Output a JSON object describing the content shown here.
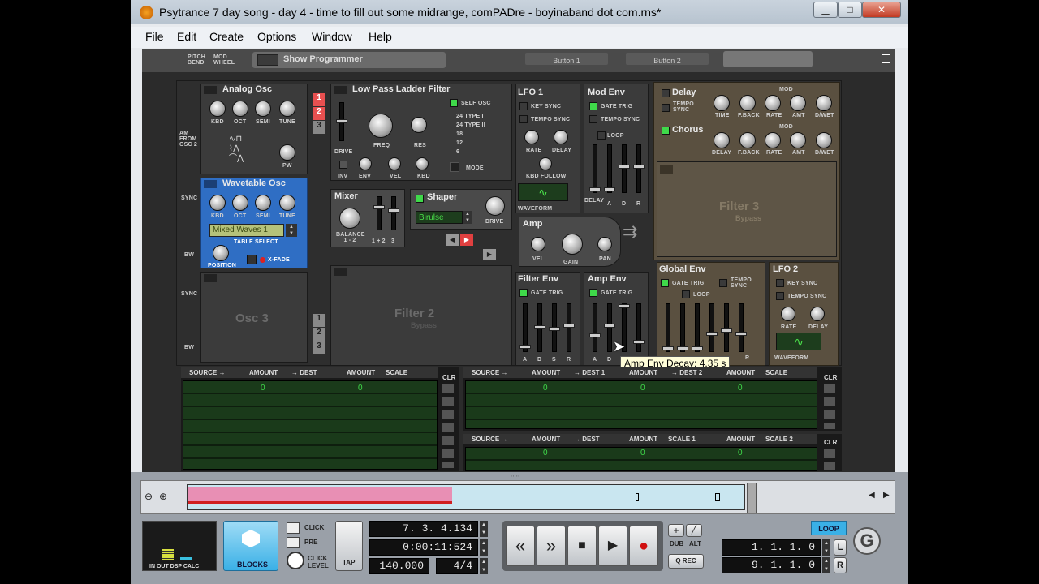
{
  "window": {
    "title": "Psytrance 7 day song - day 4 - time to fill out some midrange, comPADre - boyinaband dot com.rns*",
    "minimize": "▁",
    "maximize": "□",
    "close": "✕"
  },
  "menu": [
    "File",
    "Edit",
    "Create",
    "Options",
    "Window",
    "Help"
  ],
  "top": {
    "pitch_bend": "PITCH BEND",
    "mod_wheel": "MOD WHEEL",
    "show_programmer": "Show Programmer",
    "button1": "Button 1",
    "button2": "Button 2"
  },
  "analog_osc": {
    "title": "Analog Osc",
    "knobs": [
      "KBD",
      "OCT",
      "SEMI",
      "TUNE"
    ],
    "pw": "PW",
    "am_from": "AM FROM OSC 2"
  },
  "wavetable_osc": {
    "title": "Wavetable Osc",
    "knobs": [
      "KBD",
      "OCT",
      "SEMI",
      "TUNE"
    ],
    "wave": "Mixed Waves 1",
    "table_select": "TABLE SELECT",
    "position": "POSITION",
    "xfade": "X-FADE",
    "sync": "SYNC",
    "bw": "BW"
  },
  "osc3": {
    "title": "Osc 3",
    "sync": "SYNC",
    "bw": "BW"
  },
  "slots": [
    "1",
    "2",
    "3"
  ],
  "filter": {
    "title": "Low Pass Ladder Filter",
    "self_osc": "SELF OSC",
    "types": [
      "24 TYPE I",
      "24 TYPE II",
      "18",
      "12",
      "6"
    ],
    "mode": "MODE",
    "freq": "FREQ",
    "res": "RES",
    "drive": "DRIVE",
    "inv": "INV",
    "env": "ENV",
    "vel": "VEL",
    "kbd": "KBD"
  },
  "mixer": {
    "title": "Mixer",
    "balance": "BALANCE 1 - 2",
    "mix": "1 + 2",
    "three": "3"
  },
  "shaper": {
    "title": "Shaper",
    "mode": "Birulse",
    "drive": "DRIVE"
  },
  "amp": {
    "title": "Amp",
    "vel": "VEL",
    "gain": "GAIN",
    "pan": "PAN"
  },
  "filter2": {
    "title": "Filter 2",
    "sub": "Bypass"
  },
  "lfo1": {
    "title": "LFO 1",
    "key_sync": "KEY SYNC",
    "tempo_sync": "TEMPO SYNC",
    "rate": "RATE",
    "delay": "DELAY",
    "kbd_follow": "KBD FOLLOW",
    "waveform": "WAVEFORM"
  },
  "mod_env": {
    "title": "Mod Env",
    "gate_trig": "GATE TRIG",
    "tempo_sync": "TEMPO SYNC",
    "loop": "LOOP",
    "labels": [
      "DELAY",
      "A",
      "D",
      "R"
    ]
  },
  "filter_env": {
    "title": "Filter Env",
    "gate_trig": "GATE TRIG",
    "labels": [
      "A",
      "D",
      "S",
      "R"
    ]
  },
  "amp_env": {
    "title": "Amp Env",
    "gate_trig": "GATE TRIG",
    "labels": [
      "A",
      "D"
    ]
  },
  "tooltip": "Amp Env Decay: 4.35 s",
  "delay": {
    "title": "Delay",
    "tempo_sync": "TEMPO SYNC",
    "knobs": [
      "TIME",
      "F.BACK",
      "RATE",
      "AMT",
      "D/WET"
    ],
    "mod": "MOD"
  },
  "chorus": {
    "title": "Chorus",
    "knobs": [
      "DELAY",
      "F.BACK",
      "RATE",
      "AMT",
      "D/WET"
    ],
    "mod": "MOD"
  },
  "filter3": {
    "title": "Filter 3",
    "sub": "Bypass"
  },
  "global_env": {
    "title": "Global Env",
    "gate_trig": "GATE TRIG",
    "tempo_sync": "TEMPO SYNC",
    "loop": "LOOP",
    "r": "R"
  },
  "lfo2": {
    "title": "LFO 2",
    "key_sync": "KEY SYNC",
    "tempo_sync": "TEMPO SYNC",
    "rate": "RATE",
    "delay": "DELAY",
    "waveform": "WAVEFORM"
  },
  "mod_bus": {
    "left": {
      "source": "SOURCE →",
      "amount": "AMOUNT",
      "dest": "→ DEST",
      "amount2": "AMOUNT",
      "scale": "SCALE",
      "clr": "CLR",
      "value": "0"
    },
    "right_top": {
      "source": "SOURCE →",
      "amount": "AMOUNT",
      "dest": "→ DEST 1",
      "amount2": "AMOUNT",
      "dest2": "→ DEST 2",
      "amount3": "AMOUNT",
      "scale": "SCALE",
      "clr": "CLR",
      "value": "0"
    },
    "right_bottom": {
      "source": "SOURCE →",
      "amount": "AMOUNT",
      "dest": "→ DEST",
      "amount2": "AMOUNT",
      "scale1": "SCALE 1",
      "amount3": "AMOUNT",
      "scale2": "SCALE 2",
      "clr": "CLR",
      "value": "0"
    }
  },
  "transport": {
    "meter_labels": "IN OUT DSP CALC",
    "blocks": "BLOCKS",
    "click": "CLICK",
    "pre": "PRE",
    "click_level": "CLICK LEVEL",
    "tap": "TAP",
    "position": "7. 3. 4.134",
    "time": "0:00:11:524",
    "tempo": "140.000",
    "signature": "4/4",
    "dub": "DUB",
    "alt": "ALT",
    "qrec": "Q REC",
    "loop": "LOOP",
    "left_loc": "1. 1. 1.    0",
    "right_loc": "9. 1. 1.    0",
    "L": "L",
    "R": "R"
  }
}
